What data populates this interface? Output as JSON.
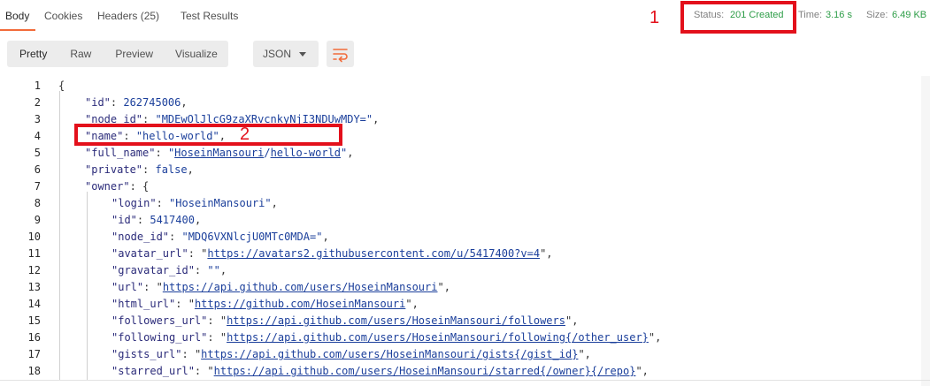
{
  "tabs": [
    {
      "label": "Body"
    },
    {
      "label": "Cookies"
    },
    {
      "label": "Headers (25)"
    },
    {
      "label": "Test Results"
    }
  ],
  "status": {
    "status_label": "Status:",
    "status_value": "201 Created",
    "time_label": "Time:",
    "time_value": "3.16 s",
    "size_label": "Size:",
    "size_value": "6.49 KB"
  },
  "annotations": {
    "first": "1",
    "second": "2"
  },
  "view_modes": [
    {
      "label": "Pretty"
    },
    {
      "label": "Raw"
    },
    {
      "label": "Preview"
    },
    {
      "label": "Visualize"
    }
  ],
  "format": {
    "selected": "JSON"
  },
  "icons": {
    "wrap": "wrap-lines-icon",
    "caret": "chevron-down-icon"
  },
  "colors": {
    "accent": "#f26b3a",
    "status_green": "#2d9d47",
    "annotation_red": "#e3101b"
  },
  "code_lines": [
    {
      "n": "1",
      "text": "{"
    },
    {
      "n": "2",
      "key": "\"id\"",
      "num": "262745006"
    },
    {
      "n": "3",
      "key": "\"node_id\"",
      "str": "\"MDEwOlJlcG9zaXRvcnkyNjI3NDUwMDY=\""
    },
    {
      "n": "4",
      "key": "\"name\"",
      "str": "\"hello-world\""
    },
    {
      "n": "5",
      "key": "\"full_name\"",
      "q1": "\"",
      "u1": "HoseinMansouri",
      "sep": "/",
      "u2": "hello-world",
      "q2": "\""
    },
    {
      "n": "6",
      "key": "\"private\"",
      "num": "false"
    },
    {
      "n": "7",
      "key": "\"owner\"",
      "open": "{"
    },
    {
      "n": "8",
      "key": "\"login\"",
      "str": "\"HoseinMansouri\""
    },
    {
      "n": "9",
      "key": "\"id\"",
      "num": "5417400"
    },
    {
      "n": "10",
      "key": "\"node_id\"",
      "str": "\"MDQ6VXNlcjU0MTc0MDA=\""
    },
    {
      "n": "11",
      "key": "\"avatar_url\"",
      "url": "https://avatars2.githubusercontent.com/u/5417400?v=4"
    },
    {
      "n": "12",
      "key": "\"gravatar_id\"",
      "str": "\"\""
    },
    {
      "n": "13",
      "key": "\"url\"",
      "url": "https://api.github.com/users/HoseinMansouri"
    },
    {
      "n": "14",
      "key": "\"html_url\"",
      "url": "https://github.com/HoseinMansouri"
    },
    {
      "n": "15",
      "key": "\"followers_url\"",
      "url": "https://api.github.com/users/HoseinMansouri/followers"
    },
    {
      "n": "16",
      "key": "\"following_url\"",
      "url": "https://api.github.com/users/HoseinMansouri/following{/other_user}"
    },
    {
      "n": "17",
      "key": "\"gists_url\"",
      "url": "https://api.github.com/users/HoseinMansouri/gists{/gist_id}"
    },
    {
      "n": "18",
      "key": "\"starred_url\"",
      "url": "https://api.github.com/users/HoseinMansouri/starred{/owner}{/repo}"
    }
  ]
}
